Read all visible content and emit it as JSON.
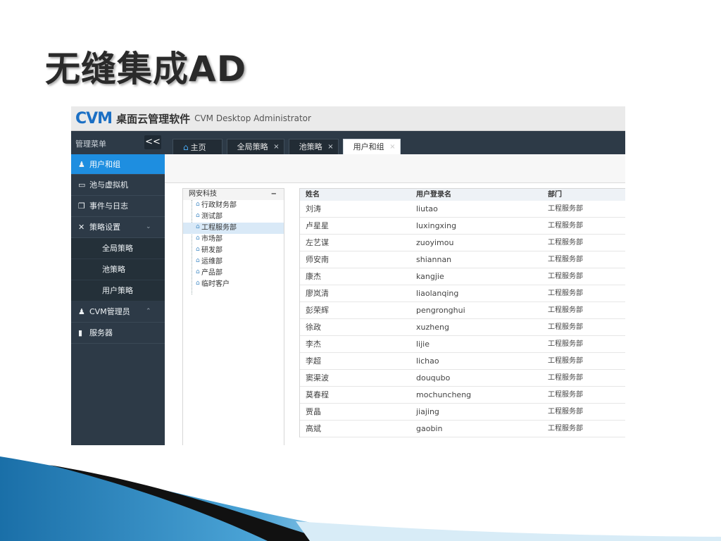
{
  "slide": {
    "title": "无缝集成AD"
  },
  "app": {
    "logo": "CVM",
    "name": "桌面云管理软件",
    "subtitle": "CVM  Desktop Administrator"
  },
  "menu": {
    "label": "管理菜单",
    "collapse_symbol": "<<",
    "items": [
      {
        "label": "用户和组",
        "icon": "users-icon"
      },
      {
        "label": "池与虚拟机",
        "icon": "monitor-icon"
      },
      {
        "label": "事件与日志",
        "icon": "log-icon"
      },
      {
        "label": "策略设置",
        "icon": "tools-icon",
        "chevron": "⌄"
      },
      {
        "label": "全局策略"
      },
      {
        "label": "池策略"
      },
      {
        "label": "用户策略"
      },
      {
        "label": "CVM管理员",
        "icon": "admin-icon",
        "chevron": "⌃"
      },
      {
        "label": "服务器",
        "icon": "server-icon"
      }
    ]
  },
  "tabs": [
    {
      "label": "主页",
      "close": ""
    },
    {
      "label": "全局策略",
      "close": "×"
    },
    {
      "label": "池策略",
      "close": "×"
    },
    {
      "label": "用户和组",
      "close": "×"
    }
  ],
  "tree": {
    "root": "网安科技",
    "collapse": "−",
    "nodes": [
      "行政财务部",
      "测试部",
      "工程服务部",
      "市场部",
      "研发部",
      "运维部",
      "产品部",
      "临时客户"
    ]
  },
  "table": {
    "headers": [
      "姓名",
      "用户登录名",
      "部门"
    ],
    "rows": [
      [
        "刘涛",
        "liutao",
        "工程服务部"
      ],
      [
        "卢星星",
        "luxingxing",
        "工程服务部"
      ],
      [
        "左艺谋",
        "zuoyimou",
        "工程服务部"
      ],
      [
        "师安南",
        "shiannan",
        "工程服务部"
      ],
      [
        "康杰",
        "kangjie",
        "工程服务部"
      ],
      [
        "廖岚清",
        "liaolanqing",
        "工程服务部"
      ],
      [
        "彭荣辉",
        "pengronghui",
        "工程服务部"
      ],
      [
        "徐政",
        "xuzheng",
        "工程服务部"
      ],
      [
        "李杰",
        "lijie",
        "工程服务部"
      ],
      [
        "李超",
        "lichao",
        "工程服务部"
      ],
      [
        "窦渠波",
        "douqubo",
        "工程服务部"
      ],
      [
        "莫春程",
        "mochuncheng",
        "工程服务部"
      ],
      [
        "贾晶",
        "jiajing",
        "工程服务部"
      ],
      [
        "高斌",
        "gaobin",
        "工程服务部"
      ]
    ]
  },
  "colors": {
    "accent": "#1e8ee0",
    "sidebar": "#2d3a47",
    "logo": "#1b6fc4"
  }
}
